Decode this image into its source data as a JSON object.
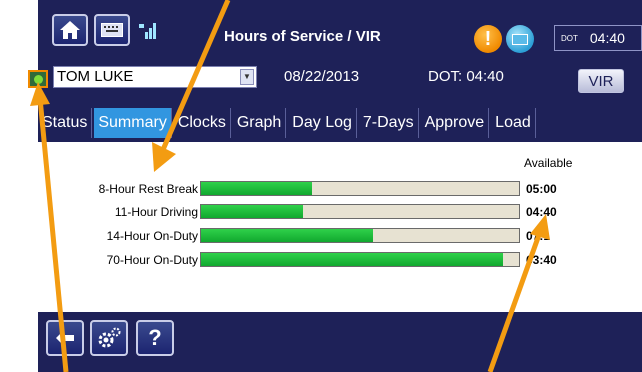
{
  "header": {
    "title": "Hours of Service / VIR",
    "dot_label": "DOT",
    "dot_clock": "04:40",
    "icons": [
      "home-icon",
      "keyboard-icon",
      "signal-icon",
      "alert-icon",
      "mail-icon"
    ]
  },
  "driver_bar": {
    "driver_name": "TOM LUKE",
    "date": "08/22/2013",
    "dot_status": "DOT: 04:40",
    "vir_button": "VIR"
  },
  "tabs": [
    {
      "label": "Status"
    },
    {
      "label": "Summary",
      "active": true
    },
    {
      "label": "Clocks"
    },
    {
      "label": "Graph"
    },
    {
      "label": "Day Log"
    },
    {
      "label": "7-Days"
    },
    {
      "label": "Approve"
    },
    {
      "label": "Load"
    }
  ],
  "summary": {
    "available_header": "Available",
    "rows": [
      {
        "label": "8-Hour Rest Break",
        "value": "05:00",
        "used_fraction": 0.35
      },
      {
        "label": "11-Hour Driving",
        "value": "04:40",
        "used_fraction": 0.32
      },
      {
        "label": "14-Hour On-Duty",
        "value": "07:1",
        "used_fraction": 0.54
      },
      {
        "label": "70-Hour On-Duty",
        "value": "63:40",
        "used_fraction": 0.95
      }
    ]
  },
  "bottom_bar": {
    "buttons": [
      "back-icon",
      "settings-icon",
      "help-icon"
    ],
    "help_glyph": "?"
  },
  "colors": {
    "background": "#1e2158",
    "active_tab": "#3296e0",
    "bar_fill": "#1ec03c",
    "bar_track": "#e7e2d2",
    "annotation_arrow": "#f39c12"
  }
}
